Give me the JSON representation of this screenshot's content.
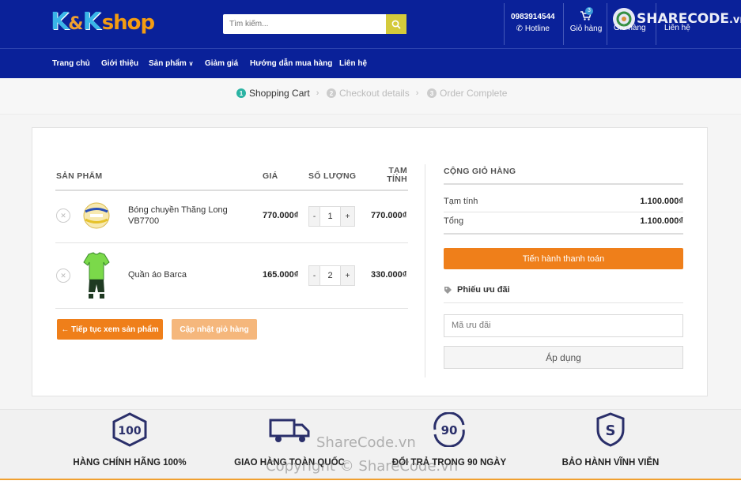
{
  "brand": {
    "logo_kk": "K",
    "logo_amp": "&",
    "logo_k2": "K",
    "logo_shop": "shop"
  },
  "search": {
    "placeholder": "Tìm kiếm..."
  },
  "header": {
    "hotline_number": "0983914544",
    "hotline_label": "Hotline",
    "cart_label": "Giỏ hàng",
    "cart_count": "3",
    "extra_1": "Giỏ hàng",
    "extra_2": "Liên hệ"
  },
  "watermark": {
    "logo_text": "SHARECODE",
    "logo_suffix": ".vn",
    "center_text": "ShareCode.vn",
    "copyright": "Copyright © ShareCode.vn"
  },
  "nav": {
    "items": [
      "Trang chủ",
      "Giới thiệu",
      "Sản phẩm",
      "Giảm giá",
      "Hướng dẫn mua hàng",
      "Liên hệ"
    ]
  },
  "steps": [
    {
      "num": "1",
      "label": "Shopping Cart"
    },
    {
      "num": "2",
      "label": "Checkout details"
    },
    {
      "num": "3",
      "label": "Order Complete"
    }
  ],
  "cart_table": {
    "headers": {
      "product": "SẢN PHẨM",
      "price": "GIÁ",
      "quantity": "SỐ LƯỢNG",
      "subtotal_1": "TẠM",
      "subtotal_2": "TÍNH"
    },
    "rows": [
      {
        "name": "Bóng chuyền Thăng Long VB7700",
        "price": "770.000₫",
        "qty": "1",
        "subtotal": "770.000₫"
      },
      {
        "name": "Quần áo Barca",
        "price": "165.000₫",
        "qty": "2",
        "subtotal": "330.000₫"
      }
    ],
    "continue_label": "← Tiếp tục xem sản phẩm",
    "update_label": "Cập nhật giỏ hàng"
  },
  "totals": {
    "title": "CỘNG GIỎ HÀNG",
    "subtotal_label": "Tạm tính",
    "subtotal_value": "1.100.000₫",
    "total_label": "Tổng",
    "total_value": "1.100.000₫",
    "checkout_label": "Tiến hành thanh toán",
    "coupon_title": "Phiếu ưu đãi",
    "coupon_placeholder": "Mã ưu đãi",
    "apply_label": "Áp dụng"
  },
  "features": [
    {
      "icon": "badge-100-icon",
      "label": "HÀNG CHÍNH HÃNG 100%"
    },
    {
      "icon": "truck-icon",
      "label": "GIAO HÀNG TOÀN QUỐC"
    },
    {
      "icon": "return-90-icon",
      "label": "ĐỔI TRẢ TRONG 90 NGÀY"
    },
    {
      "icon": "shield-s-icon",
      "label": "BẢO HÀNH VĨNH VIỄN"
    }
  ],
  "colors": {
    "header_bg": "#0a2199",
    "accent_orange": "#ef7f1a",
    "step_active": "#2bb3a3",
    "search_btn": "#d4ca3b"
  }
}
